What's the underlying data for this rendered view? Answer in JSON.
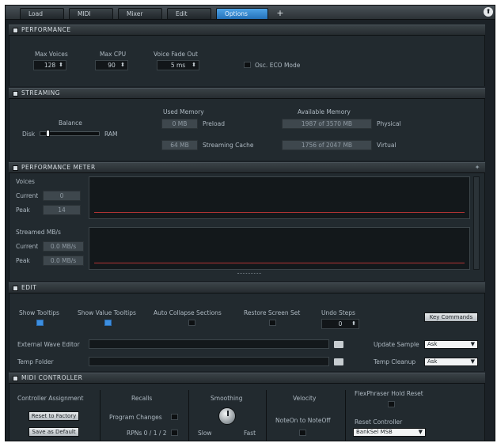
{
  "tabs": [
    {
      "label": "Load"
    },
    {
      "label": "MIDI"
    },
    {
      "label": "Mixer"
    },
    {
      "label": "Edit"
    },
    {
      "label": "Options"
    }
  ],
  "tab_add": "+",
  "performance": {
    "title": "PERFORMANCE",
    "max_voices": {
      "label": "Max Voices",
      "value": "128"
    },
    "max_cpu": {
      "label": "Max CPU",
      "value": "90"
    },
    "voice_fade_out": {
      "label": "Voice Fade Out",
      "value": "5 ms"
    },
    "osc_eco_mode": {
      "label": "Osc. ECO Mode",
      "checked": false
    }
  },
  "streaming": {
    "title": "STREAMING",
    "balance": {
      "label": "Balance",
      "left": "Disk",
      "right": "RAM",
      "position": 0.1
    },
    "used_memory_label": "Used Memory",
    "available_memory_label": "Available Memory",
    "preload": {
      "value": "0 MB",
      "label": "Preload"
    },
    "streaming_cache": {
      "value": "64 MB",
      "label": "Streaming Cache"
    },
    "physical": {
      "value": "1987 of 3570 MB",
      "label": "Physical"
    },
    "virtual": {
      "value": "1756 of 2047 MB",
      "label": "Virtual"
    }
  },
  "performance_meter": {
    "title": "PERFORMANCE METER",
    "voices": {
      "label": "Voices",
      "current_label": "Current",
      "current": "0",
      "peak_label": "Peak",
      "peak": "14"
    },
    "streamed": {
      "label": "Streamed MB/s",
      "current_label": "Current",
      "current": "0.0 MB/s",
      "peak_label": "Peak",
      "peak": "0.0 MB/s"
    }
  },
  "edit": {
    "title": "EDIT",
    "show_tooltips": {
      "label": "Show Tooltips",
      "checked": true
    },
    "show_value_tooltips": {
      "label": "Show Value Tooltips",
      "checked": true
    },
    "auto_collapse": {
      "label": "Auto Collapse Sections",
      "checked": false
    },
    "restore_screen_set": {
      "label": "Restore Screen Set",
      "checked": false
    },
    "undo_steps": {
      "label": "Undo Steps",
      "value": "0"
    },
    "key_commands": "Key Commands",
    "external_wave_editor": "External Wave Editor",
    "temp_folder": "Temp Folder",
    "update_sample": {
      "label": "Update Sample",
      "value": "Ask"
    },
    "temp_cleanup": {
      "label": "Temp Cleanup",
      "value": "Ask"
    }
  },
  "midi_controller": {
    "title": "MIDI CONTROLLER",
    "controller_assignment": "Controller Assignment",
    "reset_to_factory": "Reset to Factory",
    "save_as_default": "Save as Default",
    "recalls": "Recalls",
    "program_changes": "Program Changes",
    "rpns": "RPNs 0 / 1 / 2",
    "smoothing": "Smoothing",
    "slow": "Slow",
    "fast": "Fast",
    "velocity": "Velocity",
    "noteon_to_noteoff": "NoteOn to NoteOff",
    "flexphraser_hold_reset": "FlexPhraser Hold Reset",
    "reset_controller": "Reset Controller",
    "reset_controller_value": "BankSel MSB"
  },
  "colors": {
    "accent": "#3d8fe0",
    "meter_line": "#b33434",
    "panel": "#222a2f"
  }
}
